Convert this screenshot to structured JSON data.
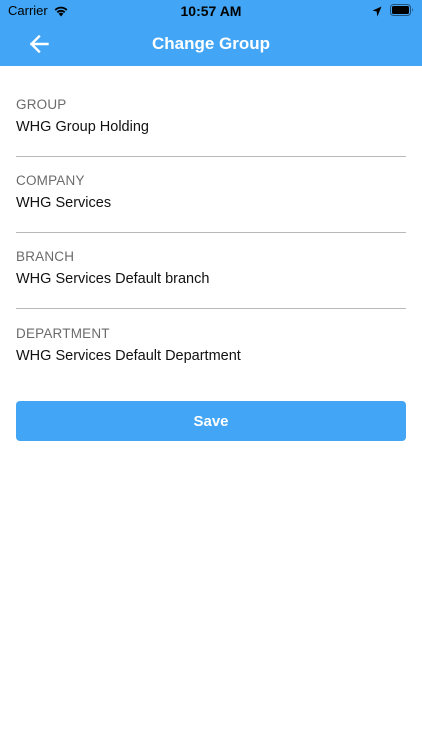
{
  "status_bar": {
    "carrier": "Carrier",
    "time": "10:57 AM",
    "icons": [
      "wifi-icon",
      "location-icon",
      "battery-icon"
    ]
  },
  "header": {
    "title": "Change Group",
    "back_icon": "arrow-left-icon",
    "background_color": "#42a5f5"
  },
  "fields": [
    {
      "label": "GROUP",
      "value": "WHG Group Holding"
    },
    {
      "label": "COMPANY",
      "value": "WHG Services"
    },
    {
      "label": "BRANCH",
      "value": "WHG Services Default branch"
    },
    {
      "label": "DEPARTMENT",
      "value": "WHG Services Default Department"
    }
  ],
  "save_button": {
    "label": "Save",
    "color": "#42a5f5"
  }
}
